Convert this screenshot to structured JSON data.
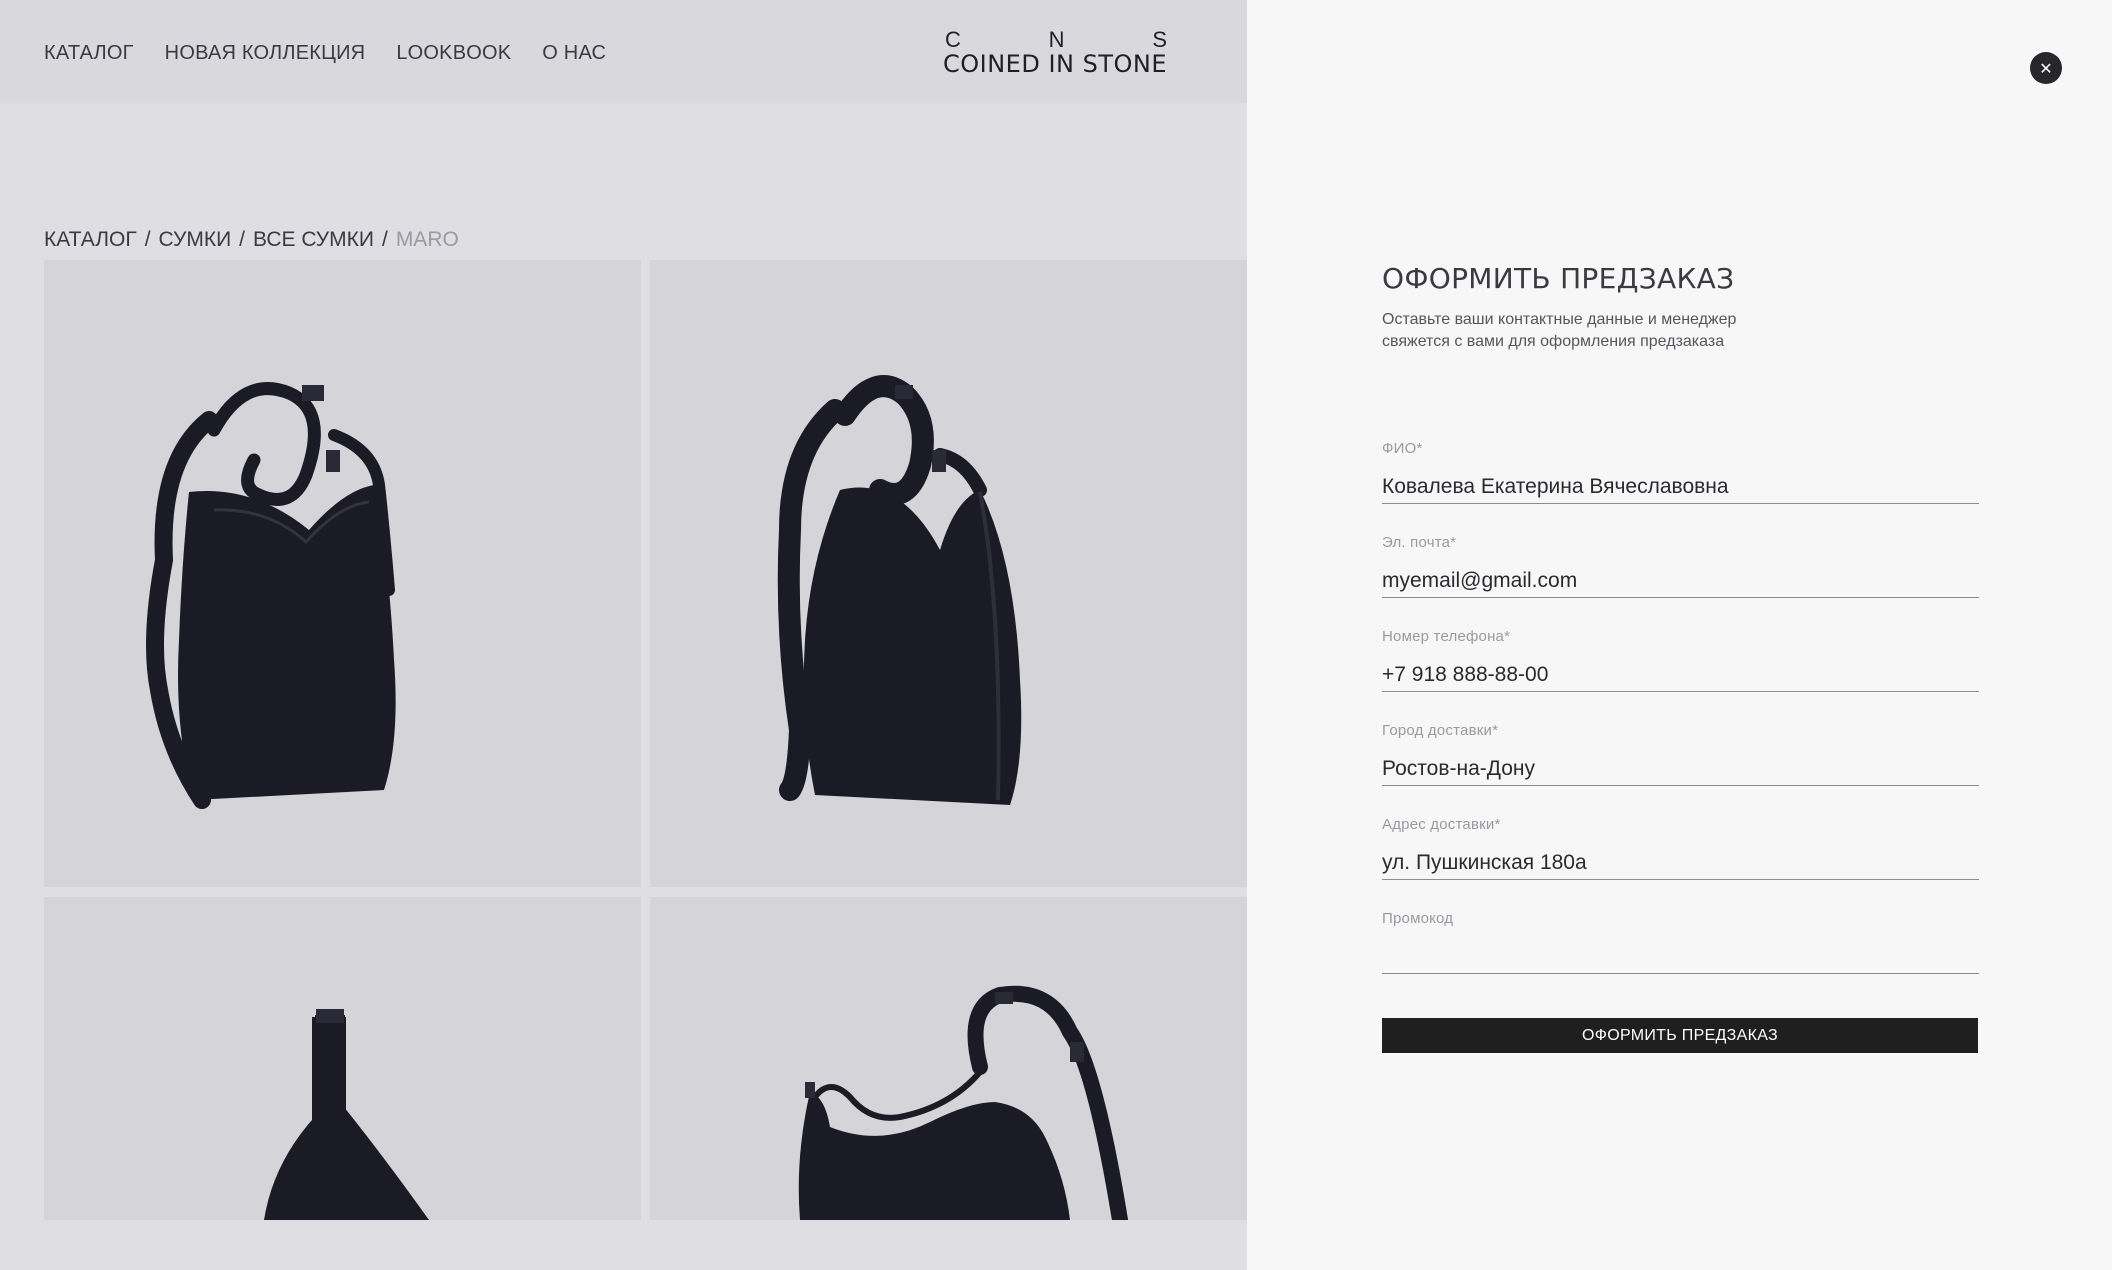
{
  "header": {
    "nav": [
      "КАТАЛОГ",
      "НОВАЯ КОЛЛЕКЦИЯ",
      "LOOKBOOK",
      "О НАС"
    ],
    "logo": {
      "letters": [
        "C",
        "N",
        "S"
      ],
      "name": "COINED IN STONE"
    }
  },
  "breadcrumb": {
    "items": [
      "КАТАЛОГ",
      "СУМКИ",
      "ВСЕ СУМКИ"
    ],
    "separator": "/",
    "current": "MARO"
  },
  "gallery": {
    "images": [
      "bag-front-view",
      "bag-angled-view",
      "bag-side-view",
      "bag-top-view"
    ]
  },
  "modal": {
    "close_icon": "close-icon",
    "title": "ОФОРМИТЬ ПРЕДЗАКАЗ",
    "subtitle": "Оставьте ваши контактные данные и менеджер свяжется с вами для оформления предзаказа",
    "fields": [
      {
        "label": "ФИО*",
        "value": "Ковалева Екатерина Вячеславовна"
      },
      {
        "label": "Эл. почта*",
        "value": "myemail@gmail.com"
      },
      {
        "label": "Номер телефона*",
        "value": "+7 918 888-88-00"
      },
      {
        "label": "Город доставки*",
        "value": "Ростов-на-Дону"
      },
      {
        "label": "Адрес доставки*",
        "value": "ул. Пушкинская 180а"
      },
      {
        "label": "Промокод",
        "value": ""
      }
    ],
    "submit_label": "ОФОРМИТЬ ПРЕДЗАКАЗ"
  },
  "colors": {
    "page_bg": "#dedee3",
    "panel_bg": "#f7f7f7",
    "button_bg": "#1f1f1f",
    "bag": "#1b1b26"
  }
}
